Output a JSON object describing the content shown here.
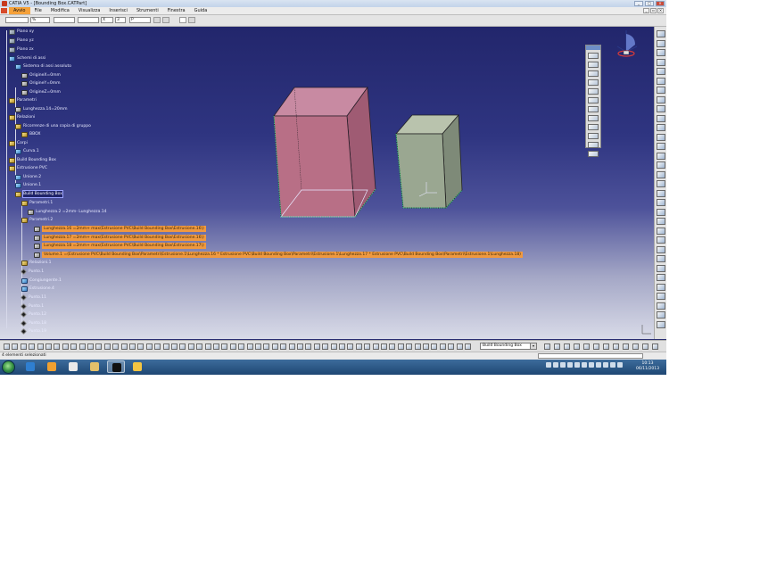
{
  "window": {
    "title": "CATIA V5 - [Bounding Box.CATPart]",
    "controls": [
      "minimize-icon",
      "maximize-icon",
      "close-icon"
    ]
  },
  "menubar": {
    "items": [
      {
        "label": "Avvio",
        "active": true
      },
      {
        "label": "File"
      },
      {
        "label": "Modifica"
      },
      {
        "label": "Visualizza"
      },
      {
        "label": "Inserisci"
      },
      {
        "label": "Strumenti"
      },
      {
        "label": "Finestra"
      },
      {
        "label": "Guida"
      }
    ]
  },
  "properties_toolbar": {
    "color_field": "",
    "transparency_field": "%",
    "line_width_field": "",
    "line_type_field": "",
    "point_symbol_field": "X",
    "layer_number": "3",
    "layer_name": "P"
  },
  "tree": {
    "nodes": [
      {
        "label": "Piano xy",
        "icon": "plane-icon"
      },
      {
        "label": "Piano yz",
        "icon": "plane-icon"
      },
      {
        "label": "Piano zx",
        "icon": "plane-icon"
      },
      {
        "label": "Schemi di assi",
        "icon": "axis-system-icon"
      },
      {
        "label": "Sistema di assi assoluto",
        "icon": "axis-system-icon"
      },
      {
        "label": "OrigineX=0mm",
        "icon": "parameter-icon"
      },
      {
        "label": "OrigineY=0mm",
        "icon": "parameter-icon"
      },
      {
        "label": "OrigineZ=0mm",
        "icon": "parameter-icon"
      },
      {
        "label": "Parametri",
        "icon": "parameters-icon"
      },
      {
        "label": "Lunghezza.14=20mm",
        "icon": "parameter-icon"
      },
      {
        "label": "Relazioni",
        "icon": "relations-icon"
      },
      {
        "label": "Ricorrenze di una copia di gruppo",
        "icon": "relations-icon"
      },
      {
        "label": "BBOX",
        "icon": "relations-icon"
      },
      {
        "label": "Corpi",
        "icon": "body-icon"
      },
      {
        "label": "Curva.1",
        "icon": "curve-icon"
      },
      {
        "label": "Build Bounding Box",
        "icon": "powercopy-icon"
      },
      {
        "label": "Estrusione PVC",
        "icon": "body-icon"
      },
      {
        "label": "Unione.2",
        "icon": "surface-icon"
      },
      {
        "label": "Unione.1",
        "icon": "surface-icon"
      },
      {
        "label": "Build Bounding Box",
        "icon": "powercopy-icon",
        "selected": true
      },
      {
        "label": "Parametri.1",
        "icon": "parameters-icon"
      },
      {
        "label": "Lunghezza.2 =2mm- Lunghezza.14",
        "icon": "parameter-icon"
      },
      {
        "label": "Parametri.2",
        "icon": "parameters-icon"
      },
      {
        "label": "Lunghezza.16 =2mm+ max(Estrusione PVC\\Build Bounding Box\\Estrusione.16\\)",
        "icon": "formula-icon",
        "highlight": true
      },
      {
        "label": "Lunghezza.17 =2mm+ max(Estrusione PVC\\Build Bounding Box\\Estrusione.16\\)",
        "icon": "formula-icon",
        "highlight": true
      },
      {
        "label": "Lunghezza.18 =2mm+ max(Estrusione PVC\\Build Bounding Box\\Estrusione.17\\)",
        "icon": "formula-icon",
        "highlight": true
      },
      {
        "label": "Volume.1 =(Estrusione PVC\\Build Bounding Box\\Parametri\\Estrusione.1\\Lunghezza.16 * Estrusione PVC\\Build Bounding Box\\Parametri\\Estrusione.1\\Lunghezza.17 * Estrusione PVC\\Build Bounding Box\\Parametri\\Estrusione.1\\Lunghezza.18)",
        "icon": "formula-icon",
        "highlight": true
      },
      {
        "label": "Relazioni.1",
        "icon": "relations-icon"
      },
      {
        "label": "Punto.1",
        "icon": "point-icon"
      },
      {
        "label": "Congiungente.1",
        "icon": "curve-icon"
      },
      {
        "label": "Estrusione.4",
        "icon": "surface-icon"
      },
      {
        "label": "Punto.11",
        "icon": "point-icon"
      },
      {
        "label": "Punto.1",
        "icon": "point-icon"
      },
      {
        "label": "Punto.12",
        "icon": "point-icon"
      },
      {
        "label": "Punto.18",
        "icon": "point-icon"
      },
      {
        "label": "Punto.19",
        "icon": "point-icon"
      }
    ]
  },
  "floating_toolbar": {
    "buttons": 12
  },
  "bottom_toolbar": {
    "command_combo": "Build Bounding Box"
  },
  "status": {
    "text": "4 elementi selezionati"
  },
  "taskbar": {
    "apps": [
      "ie-icon",
      "media-player-icon",
      "explorer-icon",
      "folder-icon",
      "catia-icon",
      "paint-icon"
    ],
    "clock_time": "10:13",
    "clock_date": "06/11/2013"
  },
  "colors": {
    "viewport_top": "#22266c",
    "viewport_bottom": "#d9dbe8",
    "box1_face": "#b86f86",
    "box2_face": "#9aa791",
    "tree_highlight": "#f0993f",
    "menu_active": "#f5a13a"
  }
}
